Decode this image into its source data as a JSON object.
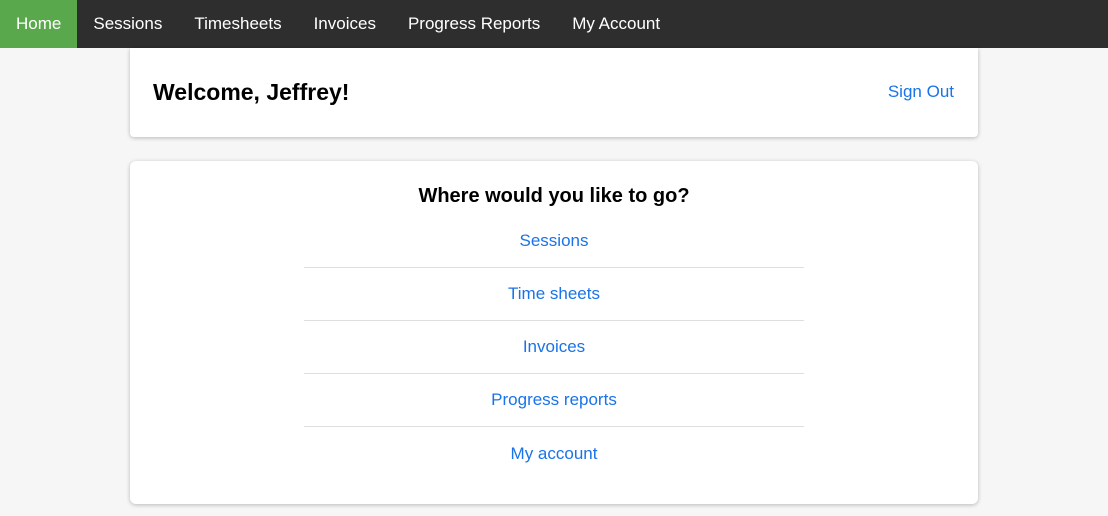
{
  "topnav": {
    "items": [
      {
        "label": "Home",
        "active": true
      },
      {
        "label": "Sessions",
        "active": false
      },
      {
        "label": "Timesheets",
        "active": false
      },
      {
        "label": "Invoices",
        "active": false
      },
      {
        "label": "Progress Reports",
        "active": false
      },
      {
        "label": "My Account",
        "active": false
      }
    ]
  },
  "welcome": {
    "title": "Welcome, Jeffrey!",
    "sign_out_label": "Sign Out"
  },
  "navigation": {
    "heading": "Where would you like to go?",
    "links": [
      {
        "label": "Sessions"
      },
      {
        "label": "Time sheets"
      },
      {
        "label": "Invoices"
      },
      {
        "label": "Progress reports"
      },
      {
        "label": "My account"
      }
    ]
  },
  "colors": {
    "nav_background": "#2e2e2e",
    "nav_active": "#5aa84c",
    "link": "#1a73e8",
    "page_background": "#f6f6f6"
  }
}
